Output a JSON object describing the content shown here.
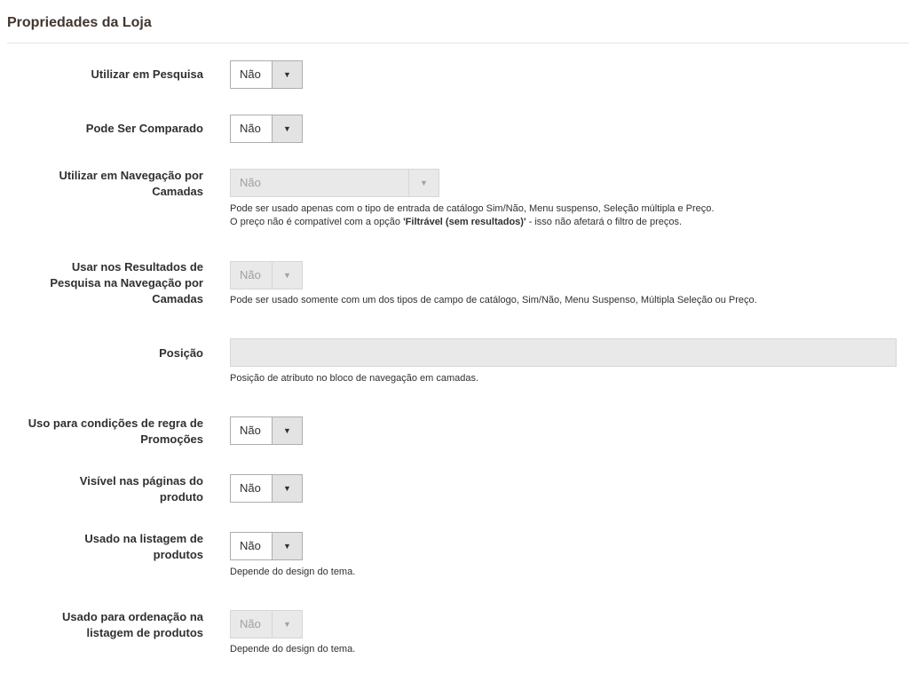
{
  "section": {
    "title": "Propriedades da Loja"
  },
  "fields": {
    "search": {
      "label": "Utilizar em Pesquisa",
      "value": "Não"
    },
    "comparable": {
      "label": "Pode Ser Comparado",
      "value": "Não"
    },
    "layered_nav": {
      "label": "Utilizar em Navegação por Camadas",
      "value": "Não",
      "note_line1": "Pode ser usado apenas com o tipo de entrada de catálogo Sim/Não, Menu suspenso, Seleção múltipla e Preço.",
      "note_line2_prefix": "O preço não é compatível com a opção ",
      "note_line2_bold": "'Filtrável (sem resultados)'",
      "note_line2_suffix": " - isso não afetará o filtro de preços."
    },
    "search_results_layered_nav": {
      "label": "Usar nos Resultados de Pesquisa na Navegação por Camadas",
      "value": "Não",
      "note": "Pode ser usado somente com um dos tipos de campo de catálogo, Sim/Não, Menu Suspenso, Múltipla Seleção ou Preço."
    },
    "position": {
      "label": "Posição",
      "value": "",
      "note": "Posição de atributo no bloco de navegação em camadas."
    },
    "promo_rules": {
      "label": "Uso para condições de regra de Promoções",
      "value": "Não"
    },
    "visible_on_front": {
      "label": "Visível nas páginas do produto",
      "value": "Não"
    },
    "used_in_listing": {
      "label": "Usado na listagem de produtos",
      "value": "Não",
      "note": "Depende do design do tema."
    },
    "used_for_sort": {
      "label": "Usado para ordenação na listagem de produtos",
      "value": "Não",
      "note": "Depende do design do tema."
    }
  },
  "icons": {
    "dropdown_arrow": "▼"
  },
  "colors": {
    "title": "#41362f",
    "border": "#adadad",
    "disabled_bg": "#e9e9e9",
    "arrow_bg": "#e3e3e3"
  }
}
